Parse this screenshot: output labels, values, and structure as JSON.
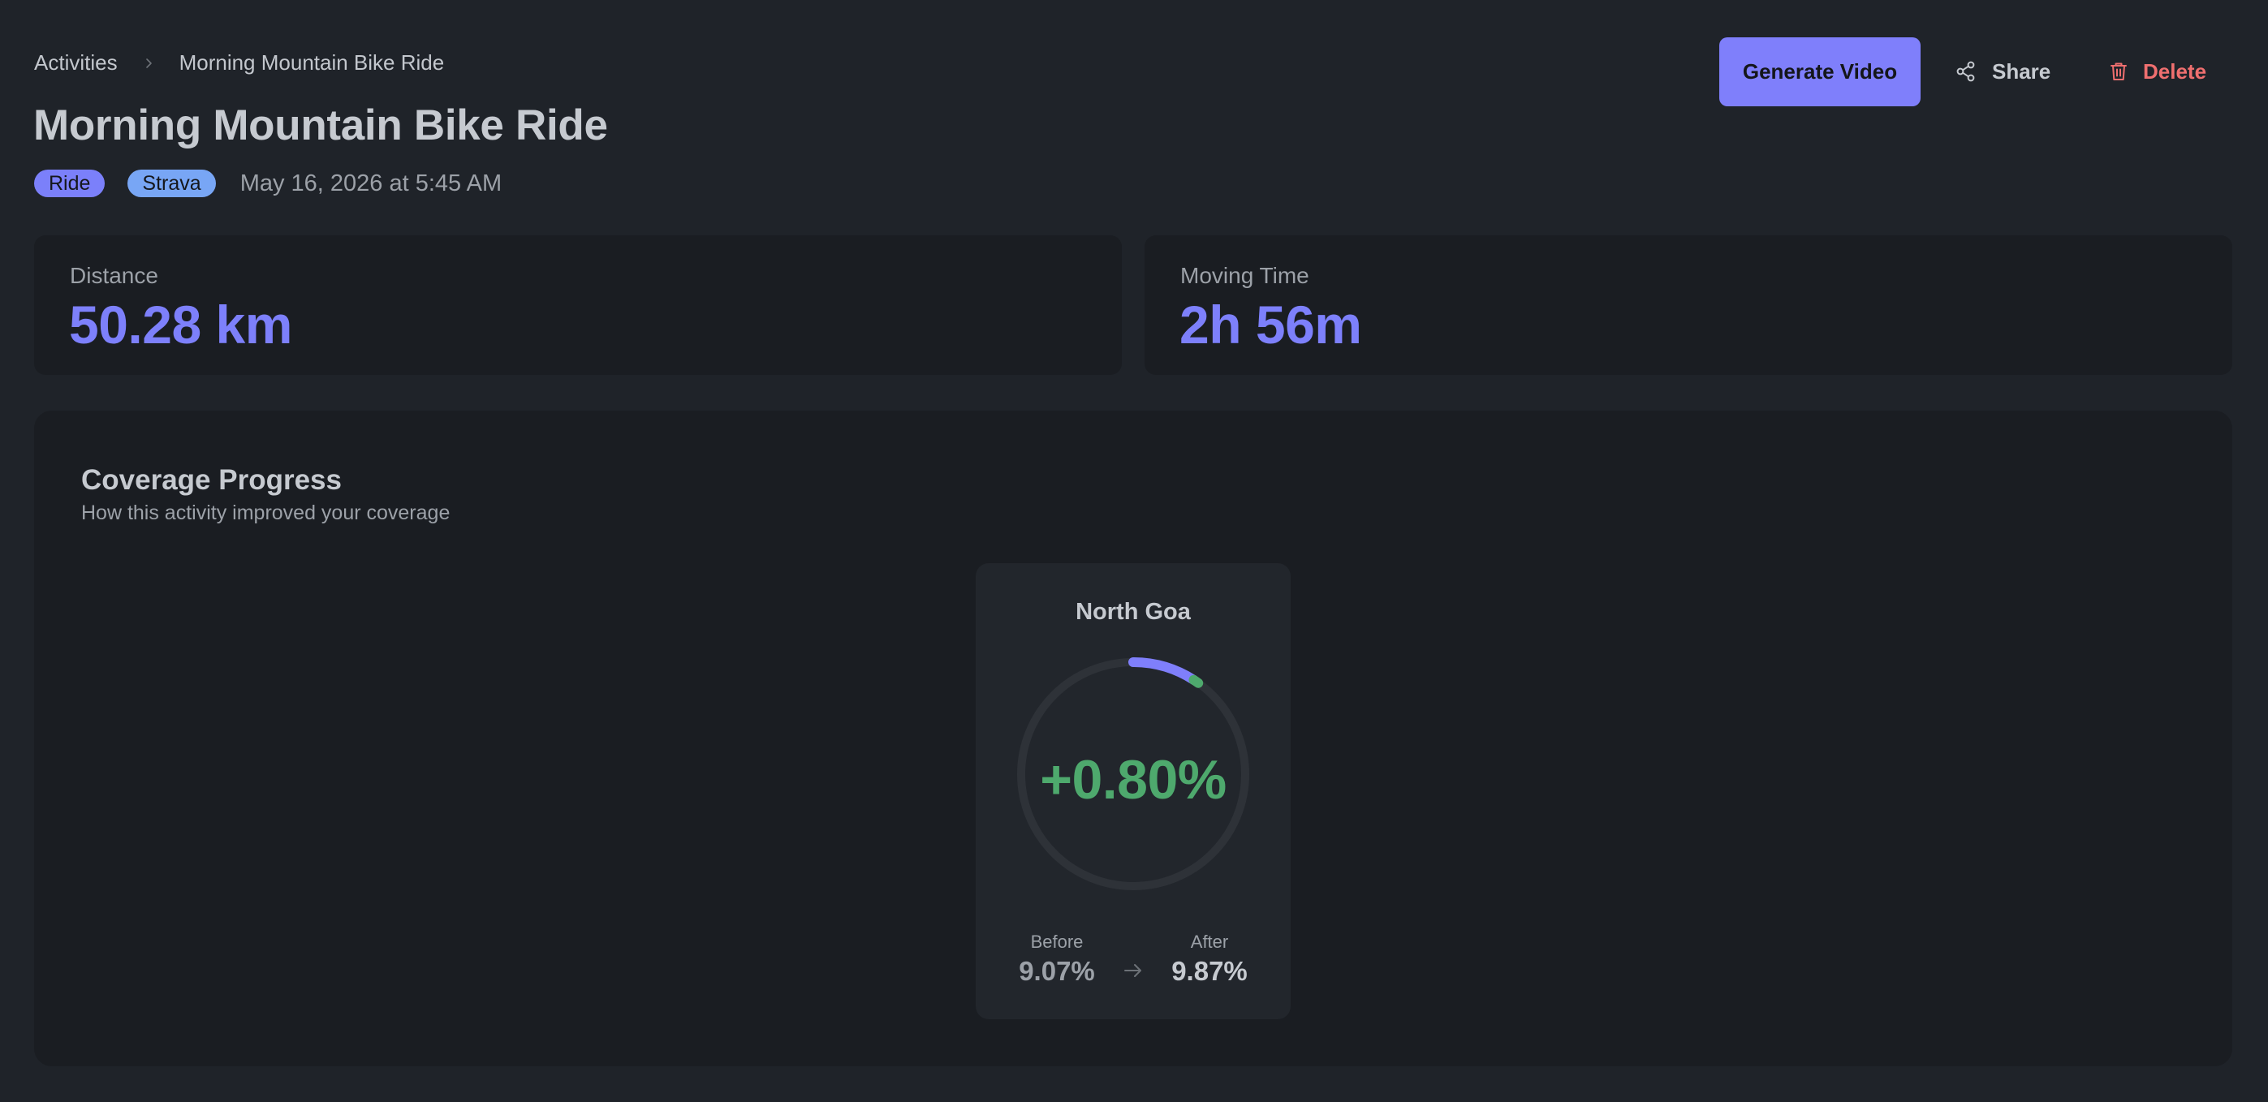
{
  "breadcrumb": {
    "parent": "Activities",
    "current": "Morning Mountain Bike Ride"
  },
  "header": {
    "title": "Morning Mountain Bike Ride",
    "tags": [
      "Ride",
      "Strava"
    ],
    "date": "May 16, 2026 at 5:45 AM"
  },
  "actions": {
    "generate_label": "Generate Video",
    "share_label": "Share",
    "delete_label": "Delete"
  },
  "stats": {
    "distance": {
      "label": "Distance",
      "value": "50.28 km"
    },
    "moving_time": {
      "label": "Moving Time",
      "value": "2h 56m"
    }
  },
  "coverage": {
    "title": "Coverage Progress",
    "subtitle": "How this activity improved your coverage",
    "region": {
      "name": "North Goa",
      "delta": "+0.80%",
      "before_label": "Before",
      "before_value": "9.07%",
      "after_label": "After",
      "after_value": "9.87%",
      "before_fraction": 0.0907,
      "after_fraction": 0.0987
    }
  },
  "colors": {
    "accent": "#7f7ffb",
    "success": "#4ea96d",
    "danger": "#ef6f6f",
    "ring_track": "#2e3238"
  }
}
